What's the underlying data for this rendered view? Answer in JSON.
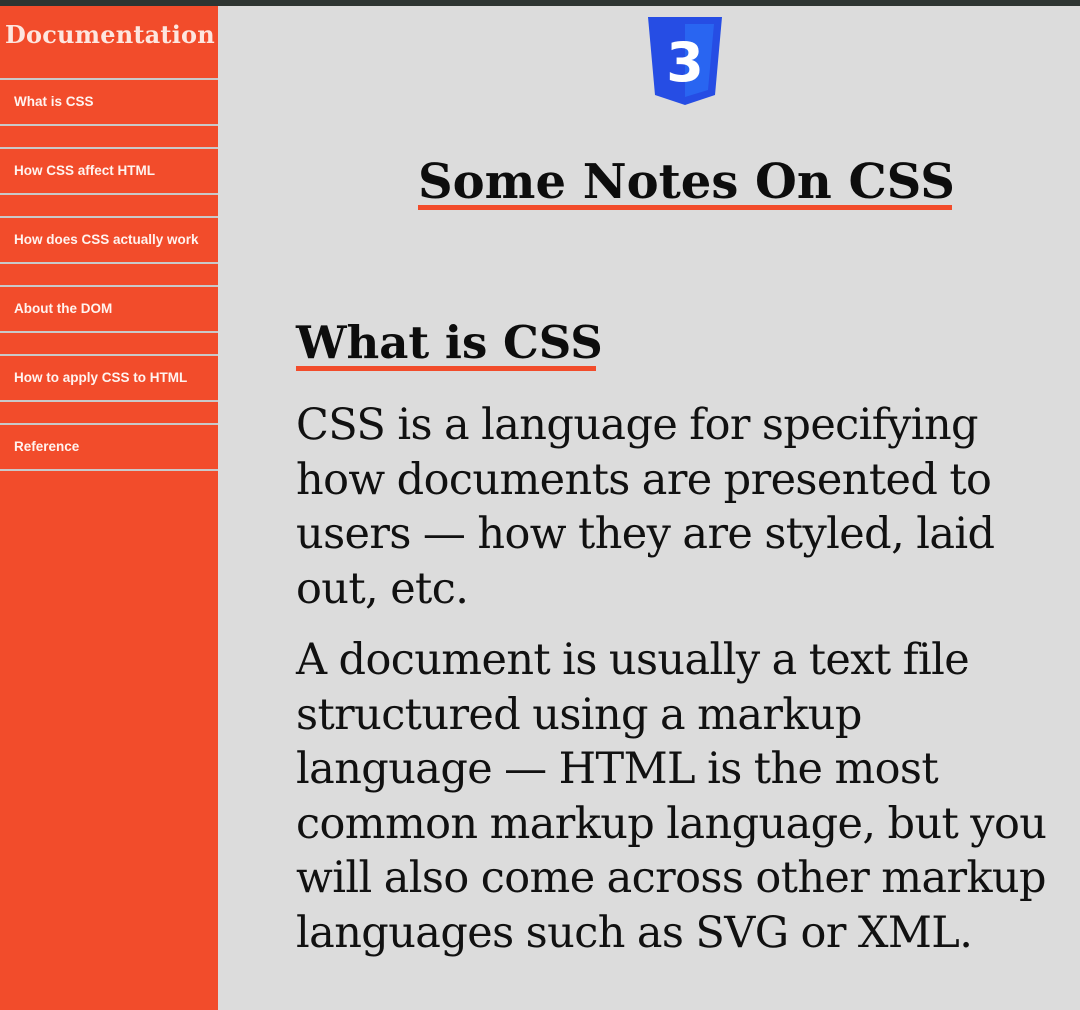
{
  "sidebar": {
    "title": "Documentation",
    "items": [
      {
        "label": "What is CSS"
      },
      {
        "label": "How CSS affect HTML"
      },
      {
        "label": "How does CSS actually work"
      },
      {
        "label": "About the DOM"
      },
      {
        "label": "How to apply CSS to HTML"
      },
      {
        "label": "Reference"
      }
    ]
  },
  "logo": {
    "icon": "css3-logo-icon",
    "glyph": "3"
  },
  "main": {
    "page_title": "Some Notes On CSS",
    "section_heading": "What is CSS",
    "paragraphs": [
      "CSS is a language for specifying how documents are presented to users — how they are styled, laid out, etc.",
      "A document is usually a text file structured using a markup language — HTML is the most common markup language, but you will also come across other markup languages such as SVG or XML."
    ]
  },
  "colors": {
    "accent": "#f24c2b",
    "background": "#dcdcdc",
    "logo_blue": "#264de4"
  }
}
